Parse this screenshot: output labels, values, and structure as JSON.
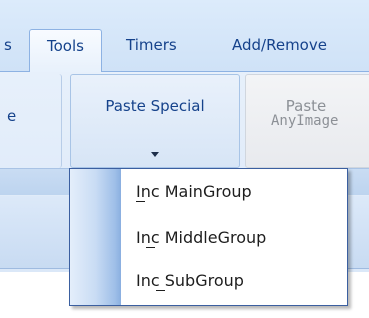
{
  "tabs": {
    "partial": "s",
    "tools": "Tools",
    "timers": "Timers",
    "add_remove": "Add/Remove"
  },
  "ribbon": {
    "left_button_partial_label": "e",
    "paste_special": "Paste Special",
    "paste": "Paste",
    "any_image": "AnyImage"
  },
  "menu": {
    "items": [
      {
        "label": "Inc MainGroup",
        "access_key": "I"
      },
      {
        "label": "Inc MiddleGroup",
        "access_key": "n"
      },
      {
        "label": "Inc SubGroup",
        "access_key": "c"
      }
    ]
  },
  "colors": {
    "tab_text": "#15428b",
    "menu_border": "#3b5fa0",
    "disabled_text": "#8c9096"
  },
  "icons": {
    "dropdown_arrow": "chevron-down-icon"
  }
}
